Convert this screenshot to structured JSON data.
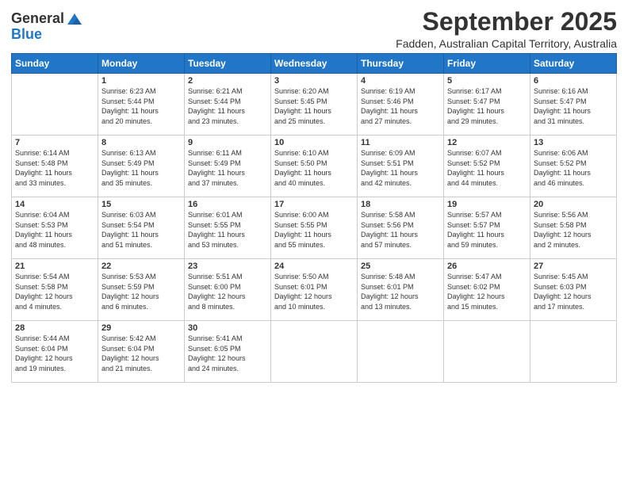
{
  "logo": {
    "general": "General",
    "blue": "Blue"
  },
  "title": "September 2025",
  "subtitle": "Fadden, Australian Capital Territory, Australia",
  "days_header": [
    "Sunday",
    "Monday",
    "Tuesday",
    "Wednesday",
    "Thursday",
    "Friday",
    "Saturday"
  ],
  "weeks": [
    [
      {
        "day": "",
        "info": ""
      },
      {
        "day": "1",
        "info": "Sunrise: 6:23 AM\nSunset: 5:44 PM\nDaylight: 11 hours\nand 20 minutes."
      },
      {
        "day": "2",
        "info": "Sunrise: 6:21 AM\nSunset: 5:44 PM\nDaylight: 11 hours\nand 23 minutes."
      },
      {
        "day": "3",
        "info": "Sunrise: 6:20 AM\nSunset: 5:45 PM\nDaylight: 11 hours\nand 25 minutes."
      },
      {
        "day": "4",
        "info": "Sunrise: 6:19 AM\nSunset: 5:46 PM\nDaylight: 11 hours\nand 27 minutes."
      },
      {
        "day": "5",
        "info": "Sunrise: 6:17 AM\nSunset: 5:47 PM\nDaylight: 11 hours\nand 29 minutes."
      },
      {
        "day": "6",
        "info": "Sunrise: 6:16 AM\nSunset: 5:47 PM\nDaylight: 11 hours\nand 31 minutes."
      }
    ],
    [
      {
        "day": "7",
        "info": "Sunrise: 6:14 AM\nSunset: 5:48 PM\nDaylight: 11 hours\nand 33 minutes."
      },
      {
        "day": "8",
        "info": "Sunrise: 6:13 AM\nSunset: 5:49 PM\nDaylight: 11 hours\nand 35 minutes."
      },
      {
        "day": "9",
        "info": "Sunrise: 6:11 AM\nSunset: 5:49 PM\nDaylight: 11 hours\nand 37 minutes."
      },
      {
        "day": "10",
        "info": "Sunrise: 6:10 AM\nSunset: 5:50 PM\nDaylight: 11 hours\nand 40 minutes."
      },
      {
        "day": "11",
        "info": "Sunrise: 6:09 AM\nSunset: 5:51 PM\nDaylight: 11 hours\nand 42 minutes."
      },
      {
        "day": "12",
        "info": "Sunrise: 6:07 AM\nSunset: 5:52 PM\nDaylight: 11 hours\nand 44 minutes."
      },
      {
        "day": "13",
        "info": "Sunrise: 6:06 AM\nSunset: 5:52 PM\nDaylight: 11 hours\nand 46 minutes."
      }
    ],
    [
      {
        "day": "14",
        "info": "Sunrise: 6:04 AM\nSunset: 5:53 PM\nDaylight: 11 hours\nand 48 minutes."
      },
      {
        "day": "15",
        "info": "Sunrise: 6:03 AM\nSunset: 5:54 PM\nDaylight: 11 hours\nand 51 minutes."
      },
      {
        "day": "16",
        "info": "Sunrise: 6:01 AM\nSunset: 5:55 PM\nDaylight: 11 hours\nand 53 minutes."
      },
      {
        "day": "17",
        "info": "Sunrise: 6:00 AM\nSunset: 5:55 PM\nDaylight: 11 hours\nand 55 minutes."
      },
      {
        "day": "18",
        "info": "Sunrise: 5:58 AM\nSunset: 5:56 PM\nDaylight: 11 hours\nand 57 minutes."
      },
      {
        "day": "19",
        "info": "Sunrise: 5:57 AM\nSunset: 5:57 PM\nDaylight: 11 hours\nand 59 minutes."
      },
      {
        "day": "20",
        "info": "Sunrise: 5:56 AM\nSunset: 5:58 PM\nDaylight: 12 hours\nand 2 minutes."
      }
    ],
    [
      {
        "day": "21",
        "info": "Sunrise: 5:54 AM\nSunset: 5:58 PM\nDaylight: 12 hours\nand 4 minutes."
      },
      {
        "day": "22",
        "info": "Sunrise: 5:53 AM\nSunset: 5:59 PM\nDaylight: 12 hours\nand 6 minutes."
      },
      {
        "day": "23",
        "info": "Sunrise: 5:51 AM\nSunset: 6:00 PM\nDaylight: 12 hours\nand 8 minutes."
      },
      {
        "day": "24",
        "info": "Sunrise: 5:50 AM\nSunset: 6:01 PM\nDaylight: 12 hours\nand 10 minutes."
      },
      {
        "day": "25",
        "info": "Sunrise: 5:48 AM\nSunset: 6:01 PM\nDaylight: 12 hours\nand 13 minutes."
      },
      {
        "day": "26",
        "info": "Sunrise: 5:47 AM\nSunset: 6:02 PM\nDaylight: 12 hours\nand 15 minutes."
      },
      {
        "day": "27",
        "info": "Sunrise: 5:45 AM\nSunset: 6:03 PM\nDaylight: 12 hours\nand 17 minutes."
      }
    ],
    [
      {
        "day": "28",
        "info": "Sunrise: 5:44 AM\nSunset: 6:04 PM\nDaylight: 12 hours\nand 19 minutes."
      },
      {
        "day": "29",
        "info": "Sunrise: 5:42 AM\nSunset: 6:04 PM\nDaylight: 12 hours\nand 21 minutes."
      },
      {
        "day": "30",
        "info": "Sunrise: 5:41 AM\nSunset: 6:05 PM\nDaylight: 12 hours\nand 24 minutes."
      },
      {
        "day": "",
        "info": ""
      },
      {
        "day": "",
        "info": ""
      },
      {
        "day": "",
        "info": ""
      },
      {
        "day": "",
        "info": ""
      }
    ]
  ]
}
